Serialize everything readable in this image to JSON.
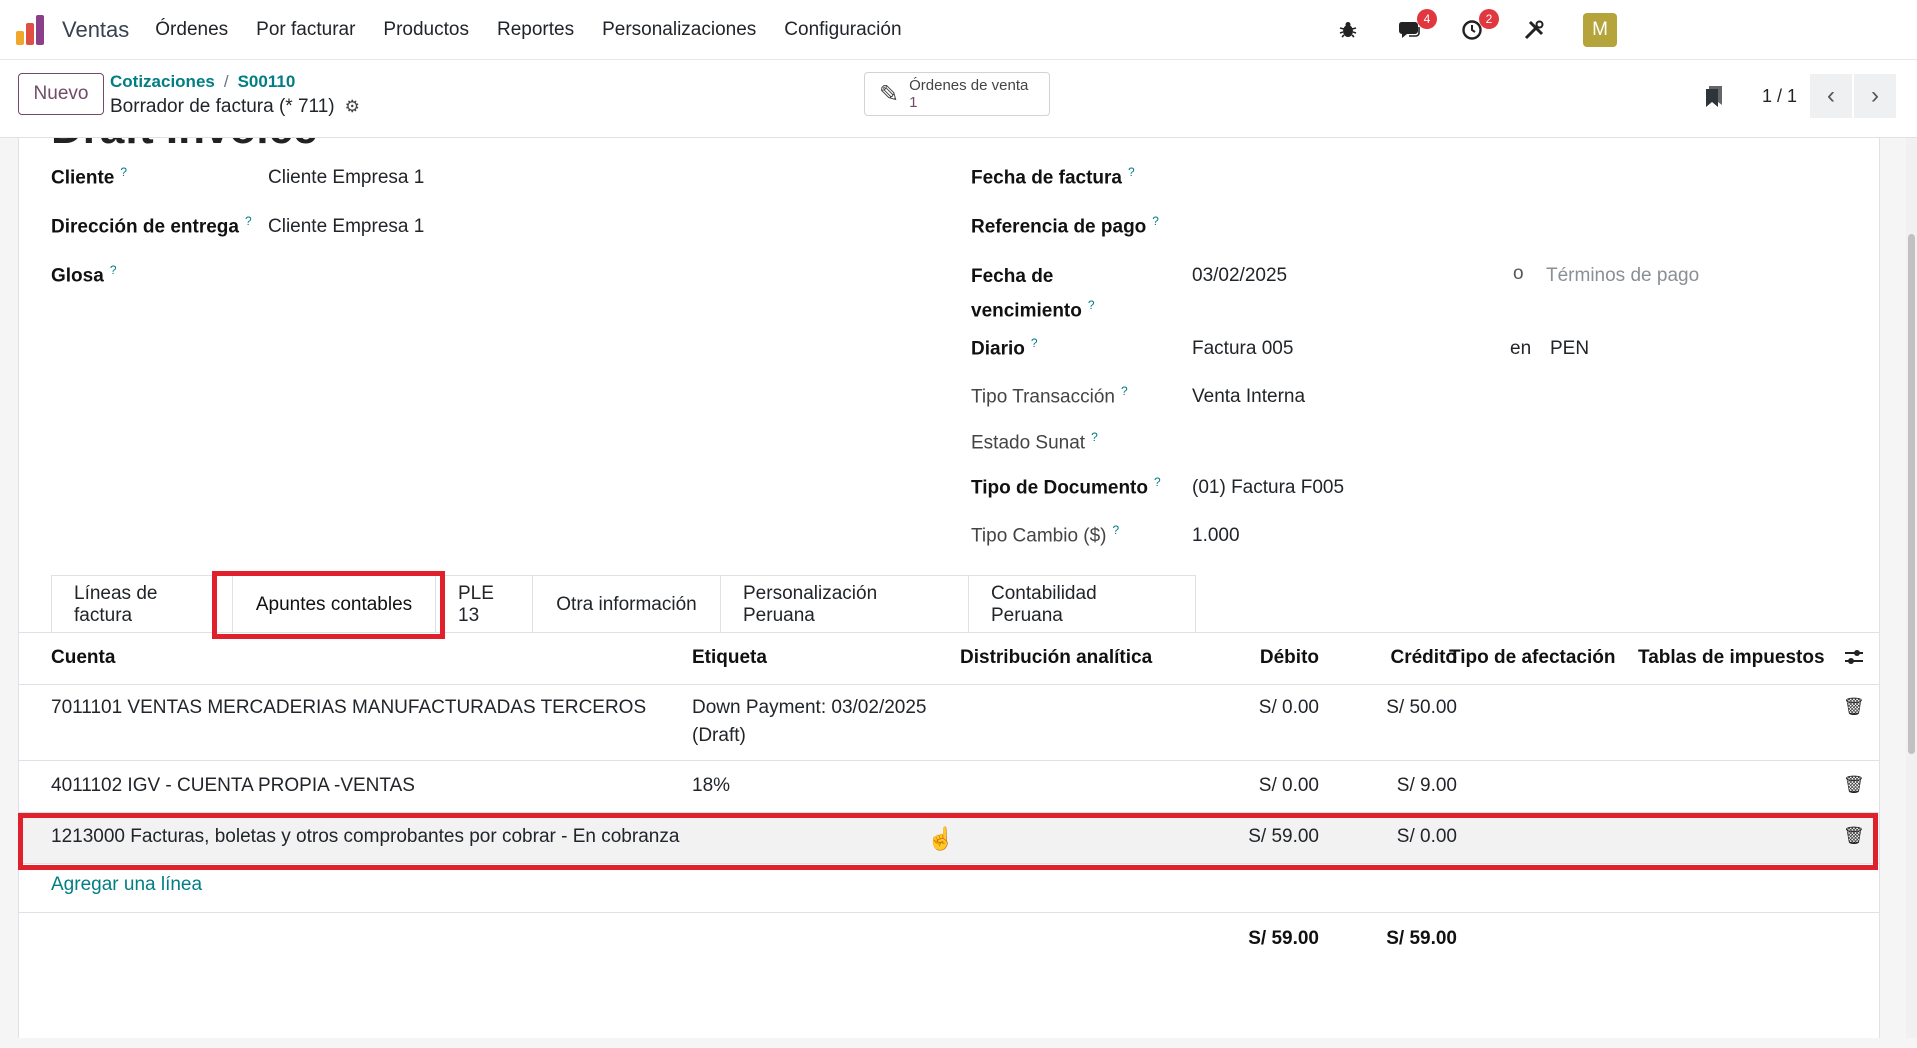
{
  "navbar": {
    "app_name": "Ventas",
    "menu": [
      "Órdenes",
      "Por facturar",
      "Productos",
      "Reportes",
      "Personalizaciones",
      "Configuración"
    ],
    "messages_badge": "4",
    "activities_badge": "2",
    "avatar_letter": "M"
  },
  "control": {
    "new_button": "Nuevo",
    "breadcrumb_parent": "Cotizaciones",
    "breadcrumb_sep": "/",
    "breadcrumb_current": "S00110",
    "record_title": "Borrador de factura (* 711)",
    "smart_button_label": "Órdenes de venta",
    "smart_button_count": "1",
    "pager": "1 / 1"
  },
  "form": {
    "title": "Draft Invoice",
    "left": {
      "cliente_label": "Cliente",
      "cliente_value": "Cliente Empresa 1",
      "direccion_label": "Dirección de entrega",
      "direccion_value": "Cliente Empresa 1",
      "glosa_label": "Glosa"
    },
    "right": {
      "fecha_factura_label": "Fecha de factura",
      "referencia_pago_label": "Referencia de pago",
      "fecha_venc_label_1": "Fecha de",
      "fecha_venc_label_2": "vencimiento",
      "fecha_venc_value": "03/02/2025",
      "o": "o",
      "terminos_placeholder": "Términos de pago",
      "diario_label": "Diario",
      "diario_value": "Factura 005",
      "en": "en",
      "currency": "PEN",
      "tipo_transaccion_label": "Tipo Transacción",
      "tipo_transaccion_value": "Venta Interna",
      "estado_sunat_label": "Estado Sunat",
      "tipo_documento_label": "Tipo de Documento",
      "tipo_documento_value": "(01) Factura F005",
      "tipo_cambio_label": "Tipo Cambio ($)",
      "tipo_cambio_value": "1.000"
    }
  },
  "tabs": [
    "Líneas de factura",
    "Apuntes contables",
    "PLE 13",
    "Otra información",
    "Personalización Peruana",
    "Contabilidad Peruana"
  ],
  "table": {
    "headers": {
      "cuenta": "Cuenta",
      "etiqueta": "Etiqueta",
      "distribucion": "Distribución analítica",
      "debito": "Débito",
      "credito": "Crédito",
      "tipo_afectacion": "Tipo de afectación",
      "tablas_impuestos": "Tablas de impuestos"
    },
    "rows": [
      {
        "cuenta": "7011101 VENTAS MERCADERIAS MANUFACTURADAS TERCEROS",
        "etiqueta_1": "Down Payment: 03/02/2025",
        "etiqueta_2": "(Draft)",
        "debito": "S/ 0.00",
        "credito": "S/ 50.00"
      },
      {
        "cuenta": "4011102 IGV - CUENTA PROPIA -VENTAS",
        "etiqueta_1": "18%",
        "debito": "S/ 0.00",
        "credito": "S/ 9.00"
      },
      {
        "cuenta": "1213000 Facturas, boletas y otros comprobantes por cobrar - En cobranza",
        "etiqueta_1": "",
        "debito": "S/ 59.00",
        "credito": "S/ 0.00"
      }
    ],
    "add_line": "Agregar una línea",
    "total_debito": "S/ 59.00",
    "total_credito": "S/ 59.00"
  },
  "colors": {
    "primary": "#714b67",
    "link": "#017e84",
    "highlight": "#e0202a"
  }
}
